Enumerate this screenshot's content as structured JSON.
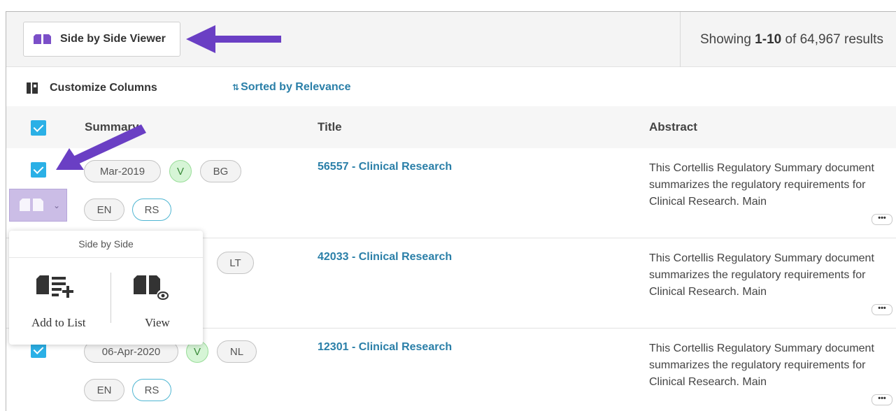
{
  "toolbar": {
    "side_by_side_label": "Side by Side Viewer",
    "results_prefix": "Showing ",
    "results_range": "1-10",
    "results_suffix": " of 64,967 results"
  },
  "options": {
    "customize_label": "Customize Columns",
    "sorted_arrows": "⇅",
    "sorted_label": "Sorted by Relevance"
  },
  "table": {
    "headers": [
      "Summary",
      "Title",
      "Abstract"
    ],
    "rows": [
      {
        "date": "Mar-2019",
        "v": "V",
        "country": "BG",
        "lang": "EN",
        "type": "RS",
        "title": "56557 - Clinical Research",
        "abstract": "This Cortellis Regulatory Summary document summarizes the regulatory requirements for Clinical Research. Main"
      },
      {
        "country": "LT",
        "title": "42033 - Clinical Research",
        "abstract": "This Cortellis Regulatory Summary document summarizes the regulatory requirements for Clinical Research. Main"
      },
      {
        "date": "06-Apr-2020",
        "v": "V",
        "country": "NL",
        "lang": "EN",
        "type": "RS",
        "title": "12301 - Clinical Research",
        "abstract": "This Cortellis Regulatory Summary document summarizes the regulatory requirements for Clinical Research. Main"
      }
    ],
    "more_label": "•••"
  },
  "popup": {
    "title": "Side by Side",
    "add_label": "Add to List",
    "view_label": "View"
  },
  "colors": {
    "accent_link": "#2a7fa8",
    "checkbox": "#2bb0e6",
    "annotation_arrow": "#6a3fc4",
    "toggle_bg": "#cbbde6"
  }
}
